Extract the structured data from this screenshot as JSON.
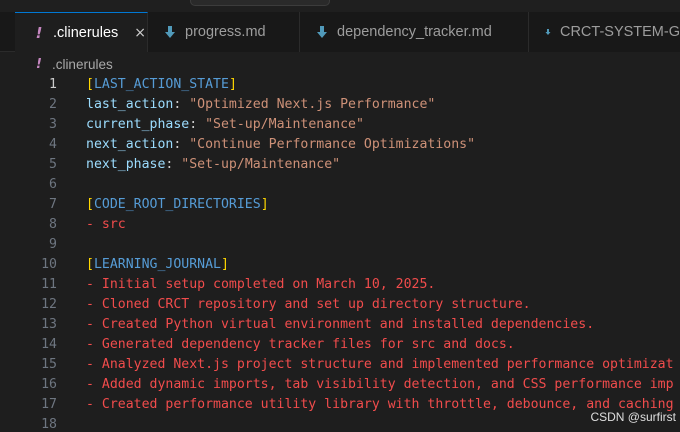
{
  "tabs": [
    {
      "label": ".clinerules",
      "icon": "exclamation-icon",
      "active": true,
      "close": "×"
    },
    {
      "label": "progress.md",
      "icon": "markdown-arrow-icon",
      "active": false
    },
    {
      "label": "dependency_tracker.md",
      "icon": "markdown-arrow-icon",
      "active": false
    },
    {
      "label": "CRCT-SYSTEM-G",
      "icon": "markdown-arrow-icon",
      "active": false
    }
  ],
  "breadcrumb": {
    "file": ".clinerules"
  },
  "editor": {
    "current_line": 1,
    "lines": [
      {
        "n": "1",
        "tokens": [
          {
            "t": "[",
            "c": "bracket"
          },
          {
            "t": "LAST_ACTION_STATE",
            "c": "section"
          },
          {
            "t": "]",
            "c": "bracket"
          }
        ]
      },
      {
        "n": "2",
        "tokens": [
          {
            "t": "last_action",
            "c": "key"
          },
          {
            "t": ": ",
            "c": "punc"
          },
          {
            "t": "\"Optimized Next.js Performance\"",
            "c": "str"
          }
        ]
      },
      {
        "n": "3",
        "tokens": [
          {
            "t": "current_phase",
            "c": "key"
          },
          {
            "t": ": ",
            "c": "punc"
          },
          {
            "t": "\"Set-up/Maintenance\"",
            "c": "str"
          }
        ]
      },
      {
        "n": "4",
        "tokens": [
          {
            "t": "next_action",
            "c": "key"
          },
          {
            "t": ": ",
            "c": "punc"
          },
          {
            "t": "\"Continue Performance Optimizations\"",
            "c": "str"
          }
        ]
      },
      {
        "n": "5",
        "tokens": [
          {
            "t": "next_phase",
            "c": "key"
          },
          {
            "t": ": ",
            "c": "punc"
          },
          {
            "t": "\"Set-up/Maintenance\"",
            "c": "str"
          }
        ]
      },
      {
        "n": "6",
        "tokens": []
      },
      {
        "n": "7",
        "tokens": [
          {
            "t": "[",
            "c": "bracket"
          },
          {
            "t": "CODE_ROOT_DIRECTORIES",
            "c": "section"
          },
          {
            "t": "]",
            "c": "bracket"
          }
        ]
      },
      {
        "n": "8",
        "tokens": [
          {
            "t": "- src",
            "c": "list"
          }
        ]
      },
      {
        "n": "9",
        "tokens": []
      },
      {
        "n": "10",
        "tokens": [
          {
            "t": "[",
            "c": "bracket"
          },
          {
            "t": "LEARNING_JOURNAL",
            "c": "section"
          },
          {
            "t": "]",
            "c": "bracket"
          }
        ]
      },
      {
        "n": "11",
        "tokens": [
          {
            "t": "- Initial setup completed on March 10, 2025.",
            "c": "list"
          }
        ]
      },
      {
        "n": "12",
        "tokens": [
          {
            "t": "- Cloned CRCT repository and set up directory structure.",
            "c": "list"
          }
        ]
      },
      {
        "n": "13",
        "tokens": [
          {
            "t": "- Created Python virtual environment and installed dependencies.",
            "c": "list"
          }
        ]
      },
      {
        "n": "14",
        "tokens": [
          {
            "t": "- Generated dependency tracker files for src and docs.",
            "c": "list"
          }
        ]
      },
      {
        "n": "15",
        "tokens": [
          {
            "t": "- Analyzed Next.js project structure and implemented performance optimizat",
            "c": "list"
          }
        ]
      },
      {
        "n": "16",
        "tokens": [
          {
            "t": "- Added dynamic imports, tab visibility detection, and CSS performance imp",
            "c": "list"
          }
        ]
      },
      {
        "n": "17",
        "tokens": [
          {
            "t": "- Created performance utility library with throttle, debounce, and caching",
            "c": "list"
          }
        ]
      },
      {
        "n": "18",
        "tokens": []
      }
    ]
  },
  "watermark": "CSDN @surfirst"
}
